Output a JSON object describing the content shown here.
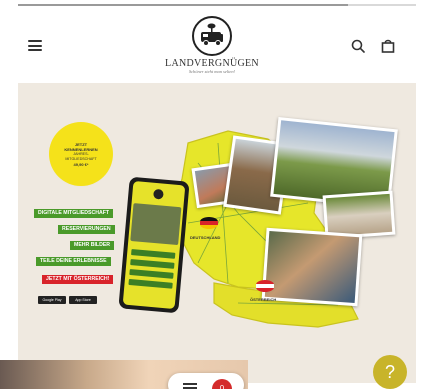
{
  "header": {
    "brand_name": "LANDVERGNÜGEN",
    "brand_tagline": "Schöner steht man selten!"
  },
  "banner": {
    "badge_lines": [
      "JETZT",
      "KENNENLERNEN",
      "JAHRES-",
      "MITGLIEDSCHAFT",
      "49,90 €*"
    ],
    "features": [
      {
        "label": "DIGITALE MITGLIEDSCHAFT",
        "color": "#4a9a2a"
      },
      {
        "label": "RESERVIERUNGEN",
        "color": "#4a9a2a"
      },
      {
        "label": "MEHR BILDER",
        "color": "#4a9a2a"
      },
      {
        "label": "TEILE DEINE ERLEBNISSE",
        "color": "#4a9a2a"
      },
      {
        "label": "JETZT MIT ÖSTERREICH!",
        "color": "#d8232a"
      }
    ],
    "stores": [
      "Google Play",
      "App Store"
    ],
    "country_labels": [
      "DEUTSCHLAND",
      "ÖSTERREICH"
    ]
  },
  "icons": {
    "menu": "hamburger-icon",
    "search": "search-icon",
    "bag": "shopping-bag-icon",
    "help": "help-icon"
  },
  "help_label": "?",
  "cart_count": "0",
  "colors": {
    "banner_bg": "#efe9e0",
    "feature_green": "#4a9a2a",
    "feature_red": "#d8232a",
    "badge_yellow": "#f5e21a",
    "help_button": "#c8b42a"
  }
}
